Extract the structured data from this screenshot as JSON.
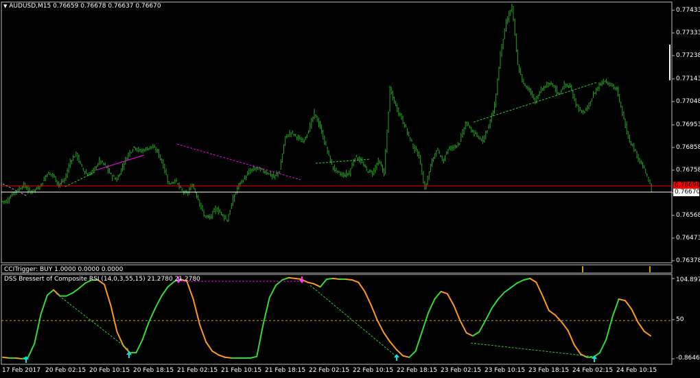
{
  "window": {
    "symbol_label": "AUDUSD,M15",
    "ohlc": [
      "0.76659",
      "0.76678",
      "0.76637",
      "0.76670"
    ],
    "menu_arrow_icon": "triangle-down-icon"
  },
  "colors": {
    "background": "#000000",
    "grid_border": "#c0c0c0",
    "bars": "#22a022",
    "last_price_line": "#ffffff",
    "alert_line": "#ff0000",
    "trend_magenta": "#ff00ff",
    "trend_green": "#33cc33",
    "dss_rising": "#33dd33",
    "dss_falling": "#ff9a1c",
    "signal_up": "#00e5e5",
    "signal_down": "#ff33ff",
    "level_line": "#c8a000"
  },
  "price_axis": {
    "ticks": [
      "0.77433",
      "0.77333",
      "0.77238",
      "0.77143",
      "0.77048",
      "0.76953",
      "0.76858",
      "0.76758",
      "0.76663",
      "0.76568",
      "0.76473",
      "0.76378"
    ],
    "current_price_tag": "0.76670",
    "alert_tag": "0.76696"
  },
  "time_axis": {
    "labels": [
      "17 Feb 2017",
      "20 Feb 02:15",
      "20 Feb 10:15",
      "20 Feb 18:15",
      "21 Feb 02:15",
      "21 Feb 10:15",
      "21 Feb 18:15",
      "22 Feb 02:15",
      "22 Feb 10:15",
      "22 Feb 18:15",
      "23 Feb 02:15",
      "23 Feb 10:15",
      "23 Feb 18:15",
      "24 Feb 02:15",
      "24 Feb 10:15"
    ]
  },
  "cci_pane": {
    "label": "CCITrigger: BUY 1.0000 0.0000 0.0000"
  },
  "dss_pane": {
    "label": "DSS Bressert of Composite RSI (14,0,3,55,15) 21.2780 21.2780",
    "ticks": [
      "104.8974",
      "50",
      "-0.8646"
    ]
  },
  "chart_data": [
    {
      "type": "line",
      "title": "AUDUSD,M15",
      "series": [
        {
          "values": [
            0.7663,
            0.7666,
            0.7668,
            0.767,
            0.7667,
            0.7668,
            0.767,
            0.7675,
            0.7674,
            0.767,
            0.7672,
            0.768,
            0.7683,
            0.7677,
            0.7674,
            0.7676,
            0.768,
            0.7678,
            0.7674,
            0.7672,
            0.7678,
            0.7683,
            0.7686,
            0.7684,
            0.7685,
            0.7686,
            0.7684,
            0.7678,
            0.767,
            0.7672,
            0.7668,
            0.7666,
            0.767,
            0.7664,
            0.7657,
            0.7656,
            0.766,
            0.7658,
            0.7655,
            0.7664,
            0.767,
            0.7673,
            0.7676,
            0.7677,
            0.7676,
            0.7675,
            0.7673,
            0.7676,
            0.769,
            0.7692,
            0.769,
            0.7688,
            0.7693,
            0.77,
            0.7694,
            0.7686,
            0.7678,
            0.7675,
            0.7674,
            0.7675,
            0.7682,
            0.768,
            0.7676,
            0.7675,
            0.768,
            0.7675,
            0.771,
            0.7703,
            0.7698,
            0.7692,
            0.7686,
            0.7682,
            0.7668,
            0.7678,
            0.7685,
            0.768,
            0.7685,
            0.7686,
            0.7688,
            0.7696,
            0.7693,
            0.769,
            0.7689,
            0.7695,
            0.7703,
            0.7725,
            0.7738,
            0.7745,
            0.772,
            0.7712,
            0.771,
            0.7705,
            0.771,
            0.7712,
            0.7712,
            0.7708,
            0.7712,
            0.7711,
            0.7704,
            0.77,
            0.7702,
            0.7708,
            0.7712,
            0.7714,
            0.7712,
            0.771,
            0.77,
            0.769,
            0.7685,
            0.768,
            0.7675,
            0.7668
          ]
        }
      ],
      "ylim": [
        0.76378,
        0.77433
      ]
    },
    {
      "type": "line",
      "title": "DSS Bressert of Composite RSI (14,0,3,55,15) 21.2780 21.2780",
      "series": [
        {
          "values": [
            2,
            1,
            1,
            0,
            2,
            20,
            58,
            83,
            90,
            82,
            82,
            86,
            92,
            99,
            103,
            103,
            97,
            70,
            35,
            17,
            8,
            8,
            25,
            48,
            66,
            82,
            94,
            101,
            104,
            101,
            78,
            45,
            22,
            10,
            5,
            2,
            1,
            1,
            1,
            1,
            3,
            45,
            80,
            96,
            103,
            106,
            105,
            104,
            100,
            98,
            94,
            104,
            105,
            104,
            104,
            103,
            100,
            88,
            70,
            50,
            34,
            22,
            12,
            4,
            2,
            10,
            35,
            60,
            78,
            88,
            85,
            70,
            50,
            34,
            30,
            35,
            50,
            66,
            78,
            87,
            93,
            99,
            103,
            105,
            100,
            82,
            63,
            57,
            48,
            37,
            18,
            6,
            2,
            2,
            8,
            25,
            55,
            78,
            76,
            65,
            48,
            36,
            30
          ]
        }
      ],
      "ylim": [
        -0.8646,
        104.8974
      ]
    }
  ]
}
